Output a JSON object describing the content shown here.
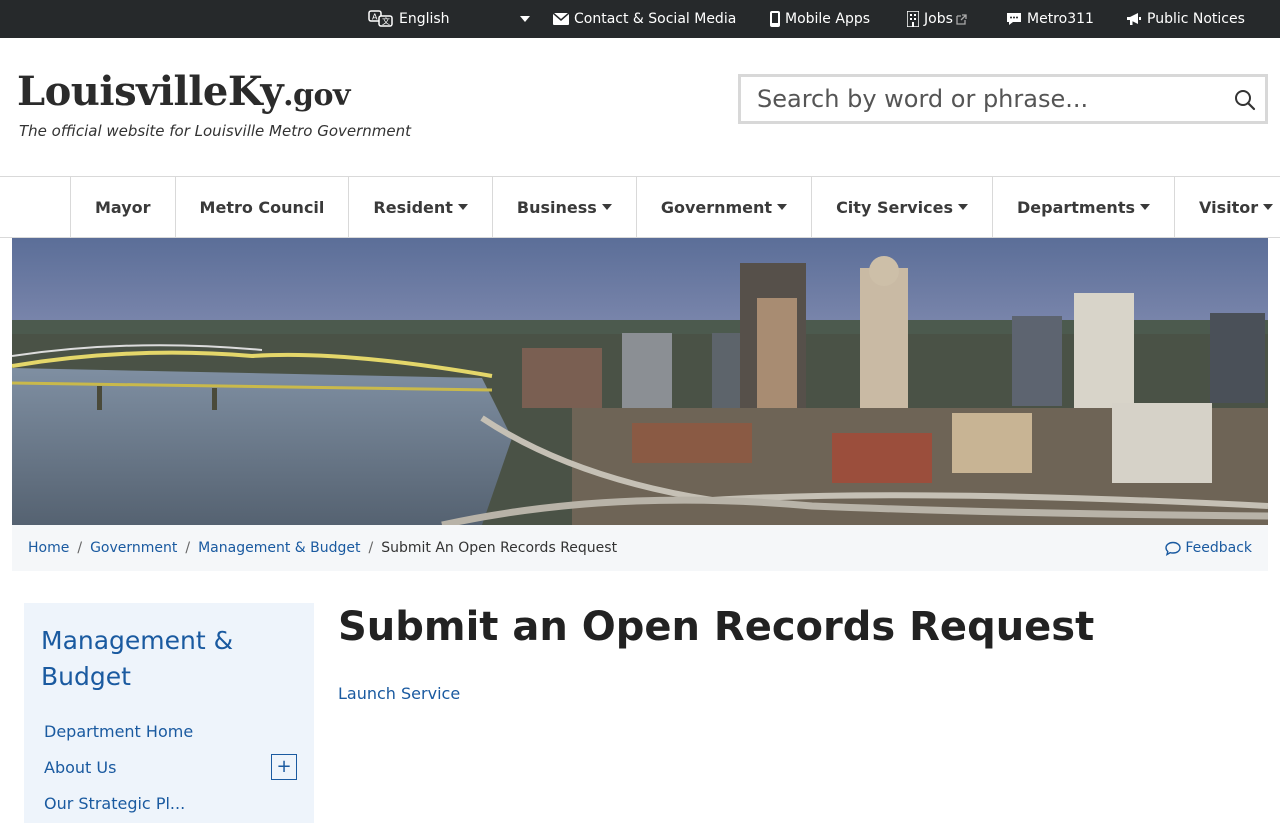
{
  "utility_bar": {
    "language": "English",
    "links": {
      "contact": "Contact & Social Media",
      "mobile_apps": "Mobile Apps",
      "jobs": "Jobs",
      "metro311": "Metro311",
      "public_notices": "Public Notices"
    }
  },
  "header": {
    "logo_main": "LouisvilleKy",
    "logo_suffix": ".gov",
    "tagline": "The official website for Louisville Metro Government",
    "search_placeholder": "Search by word or phrase..."
  },
  "nav": {
    "mayor": "Mayor",
    "metro_council": "Metro Council",
    "resident": "Resident",
    "business": "Business",
    "government": "Government",
    "city_services": "City Services",
    "departments": "Departments",
    "visitor": "Visitor"
  },
  "breadcrumb": {
    "home": "Home",
    "government": "Government",
    "management": "Management & Budget",
    "current": "Submit An Open Records Request",
    "separator": "/"
  },
  "feedback": "Feedback",
  "sidebar": {
    "title": "Management & Budget",
    "department_home": "Department Home",
    "about_us": "About Us",
    "strategic_plan": "Our Strategic Pl...",
    "expand_symbol": "+"
  },
  "main": {
    "title": "Submit an Open Records Request",
    "launch_link": "Launch Service"
  },
  "colors": {
    "utility_bg": "#26292b",
    "link": "#1a5aa0",
    "sidebar_bg": "#eef4fb",
    "breadcrumb_bg": "#f5f7f9"
  }
}
